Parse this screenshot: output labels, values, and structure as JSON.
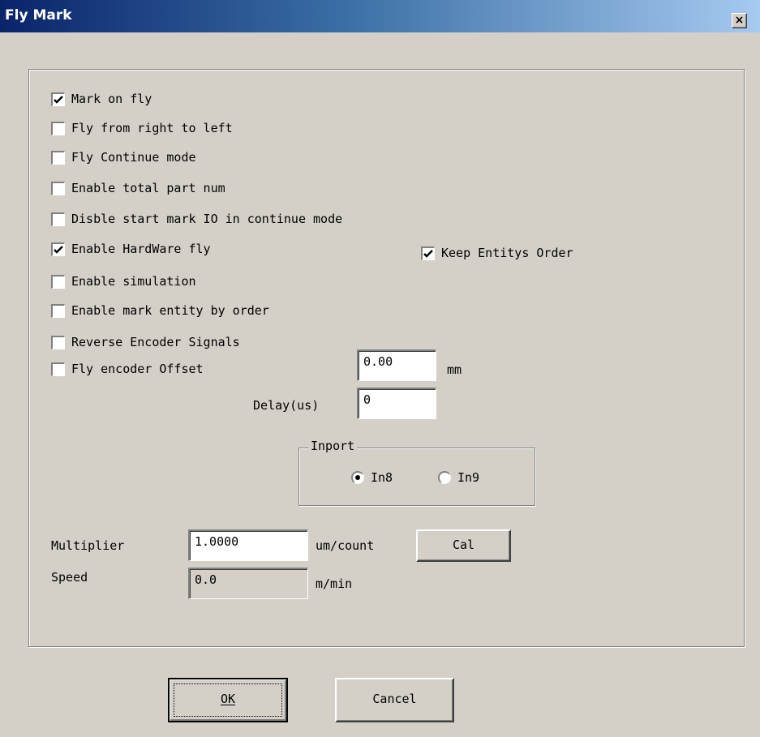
{
  "window": {
    "title": "Fly Mark",
    "close_label": "×"
  },
  "checkboxes": [
    {
      "label": "Mark on fly",
      "checked": true
    },
    {
      "label": "Fly from right to left",
      "checked": false
    },
    {
      "label": "Fly Continue mode",
      "checked": false
    },
    {
      "label": "Enable total part num",
      "checked": false
    },
    {
      "label": "Disble start mark IO in continue mode",
      "checked": false
    },
    {
      "label": "Enable HardWare fly",
      "checked": true
    },
    {
      "label": "Keep Entitys Order",
      "checked": true
    },
    {
      "label": "Enable simulation",
      "checked": false
    },
    {
      "label": "Enable mark entity by order",
      "checked": false
    },
    {
      "label": "Reverse Encoder Signals",
      "checked": false
    },
    {
      "label": "Fly encoder Offset",
      "checked": false
    }
  ],
  "encoder_offset": {
    "value": "0.00",
    "unit": "mm"
  },
  "delay": {
    "label": "Delay(us)",
    "value": "0"
  },
  "inport": {
    "title": "Inport",
    "options": [
      "In8",
      "In9"
    ],
    "selected": "In8"
  },
  "multiplier": {
    "label": "Multiplier",
    "value": "1.0000",
    "unit": "um/count",
    "cal_label": "Cal"
  },
  "speed": {
    "label": "Speed",
    "value": "0.0",
    "unit": "m/min"
  },
  "buttons": {
    "ok": "OK",
    "cancel": "Cancel"
  }
}
